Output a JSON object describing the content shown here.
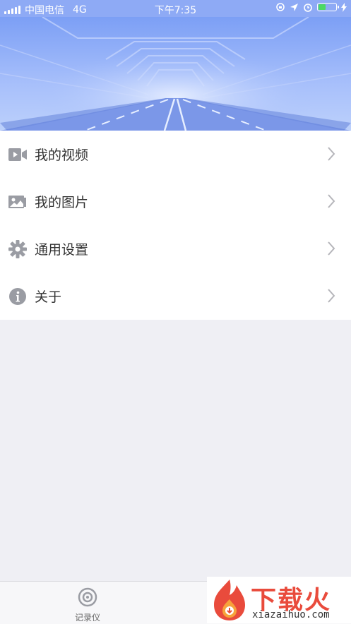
{
  "status_bar": {
    "carrier": "中国电信",
    "network": "4G",
    "time": "下午7:35"
  },
  "menu": {
    "items": [
      {
        "label": "我的视频",
        "icon": "video-camera-icon"
      },
      {
        "label": "我的图片",
        "icon": "photo-icon"
      },
      {
        "label": "通用设置",
        "icon": "gear-icon"
      },
      {
        "label": "关于",
        "icon": "info-icon"
      }
    ]
  },
  "tabbar": {
    "record_label": "记录仪"
  },
  "watermark": {
    "title": "下载火",
    "url": "xiazaihuo.com"
  },
  "colors": {
    "status_bar": "#8eaaf5",
    "banner_top": "#7c9ff5",
    "battery": "#4cd964",
    "icon_gray": "#9a9ca3",
    "watermark_red": "#e94b3c"
  }
}
